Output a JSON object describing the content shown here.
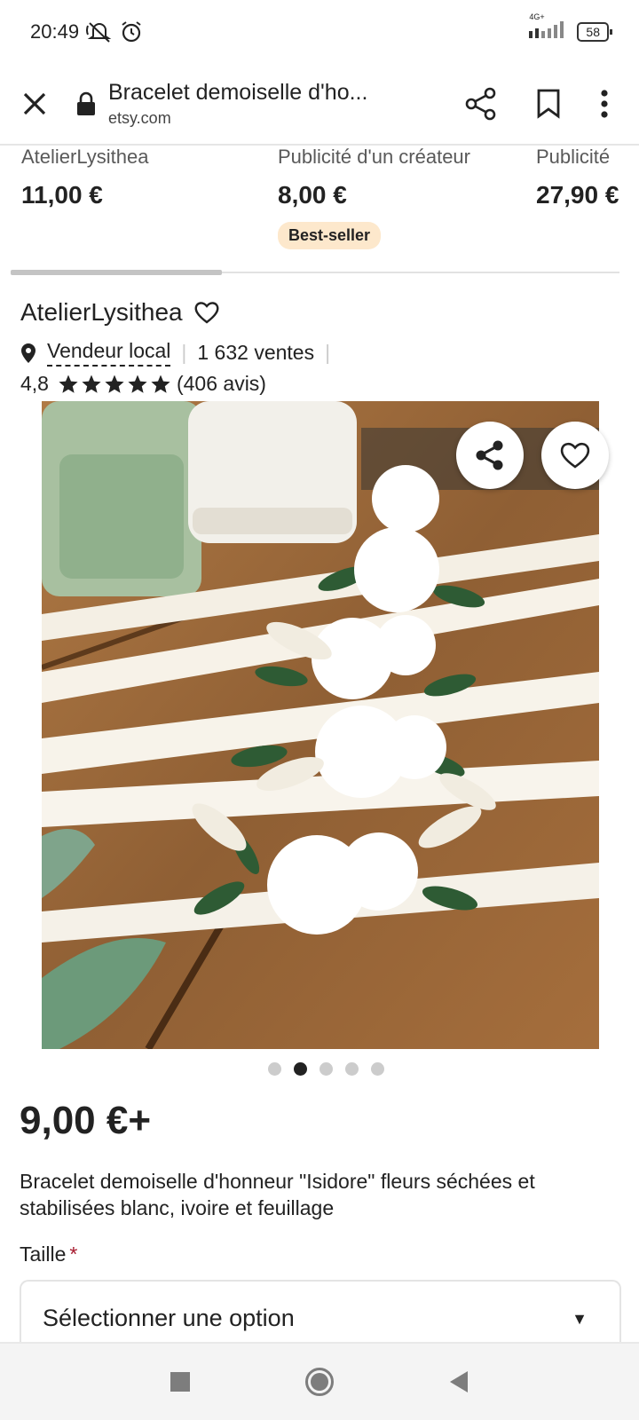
{
  "status": {
    "time": "20:49",
    "battery": "58",
    "network": "4G+"
  },
  "browser": {
    "title": "Bracelet demoiselle d'ho...",
    "domain": "etsy.com"
  },
  "recommendations": [
    {
      "seller": "AtelierLysithea",
      "price": "11,00 €",
      "badge": ""
    },
    {
      "seller": "Publicité d'un créateur",
      "price": "8,00 €",
      "badge": "Best-seller"
    },
    {
      "seller": "Publicité",
      "price": "27,90 €",
      "badge": ""
    }
  ],
  "shop": {
    "name": "AtelierLysithea",
    "local_label": "Vendeur local",
    "sales": "1 632 ventes",
    "rating": "4,8",
    "rating_stars": 5,
    "reviews": "(406 avis)"
  },
  "gallery": {
    "image_count": 5,
    "current_index": 1
  },
  "product": {
    "price": "9,00 €+",
    "title": "Bracelet demoiselle d'honneur \"Isidore\" fleurs séchées et stabilisées blanc, ivoire et feuillage"
  },
  "variation": {
    "label": "Taille",
    "required_mark": "*",
    "placeholder": "Sélectionner une option"
  },
  "icons": {
    "close": "close-icon",
    "lock": "lock-icon",
    "share": "share-icon",
    "bookmark": "bookmark-icon",
    "more": "more-vert-icon",
    "heart": "heart-icon",
    "location": "location-pin-icon",
    "star": "star-icon"
  },
  "colors": {
    "badge_bg": "#fde8cc",
    "required": "#a61a2e",
    "text": "#222222"
  }
}
